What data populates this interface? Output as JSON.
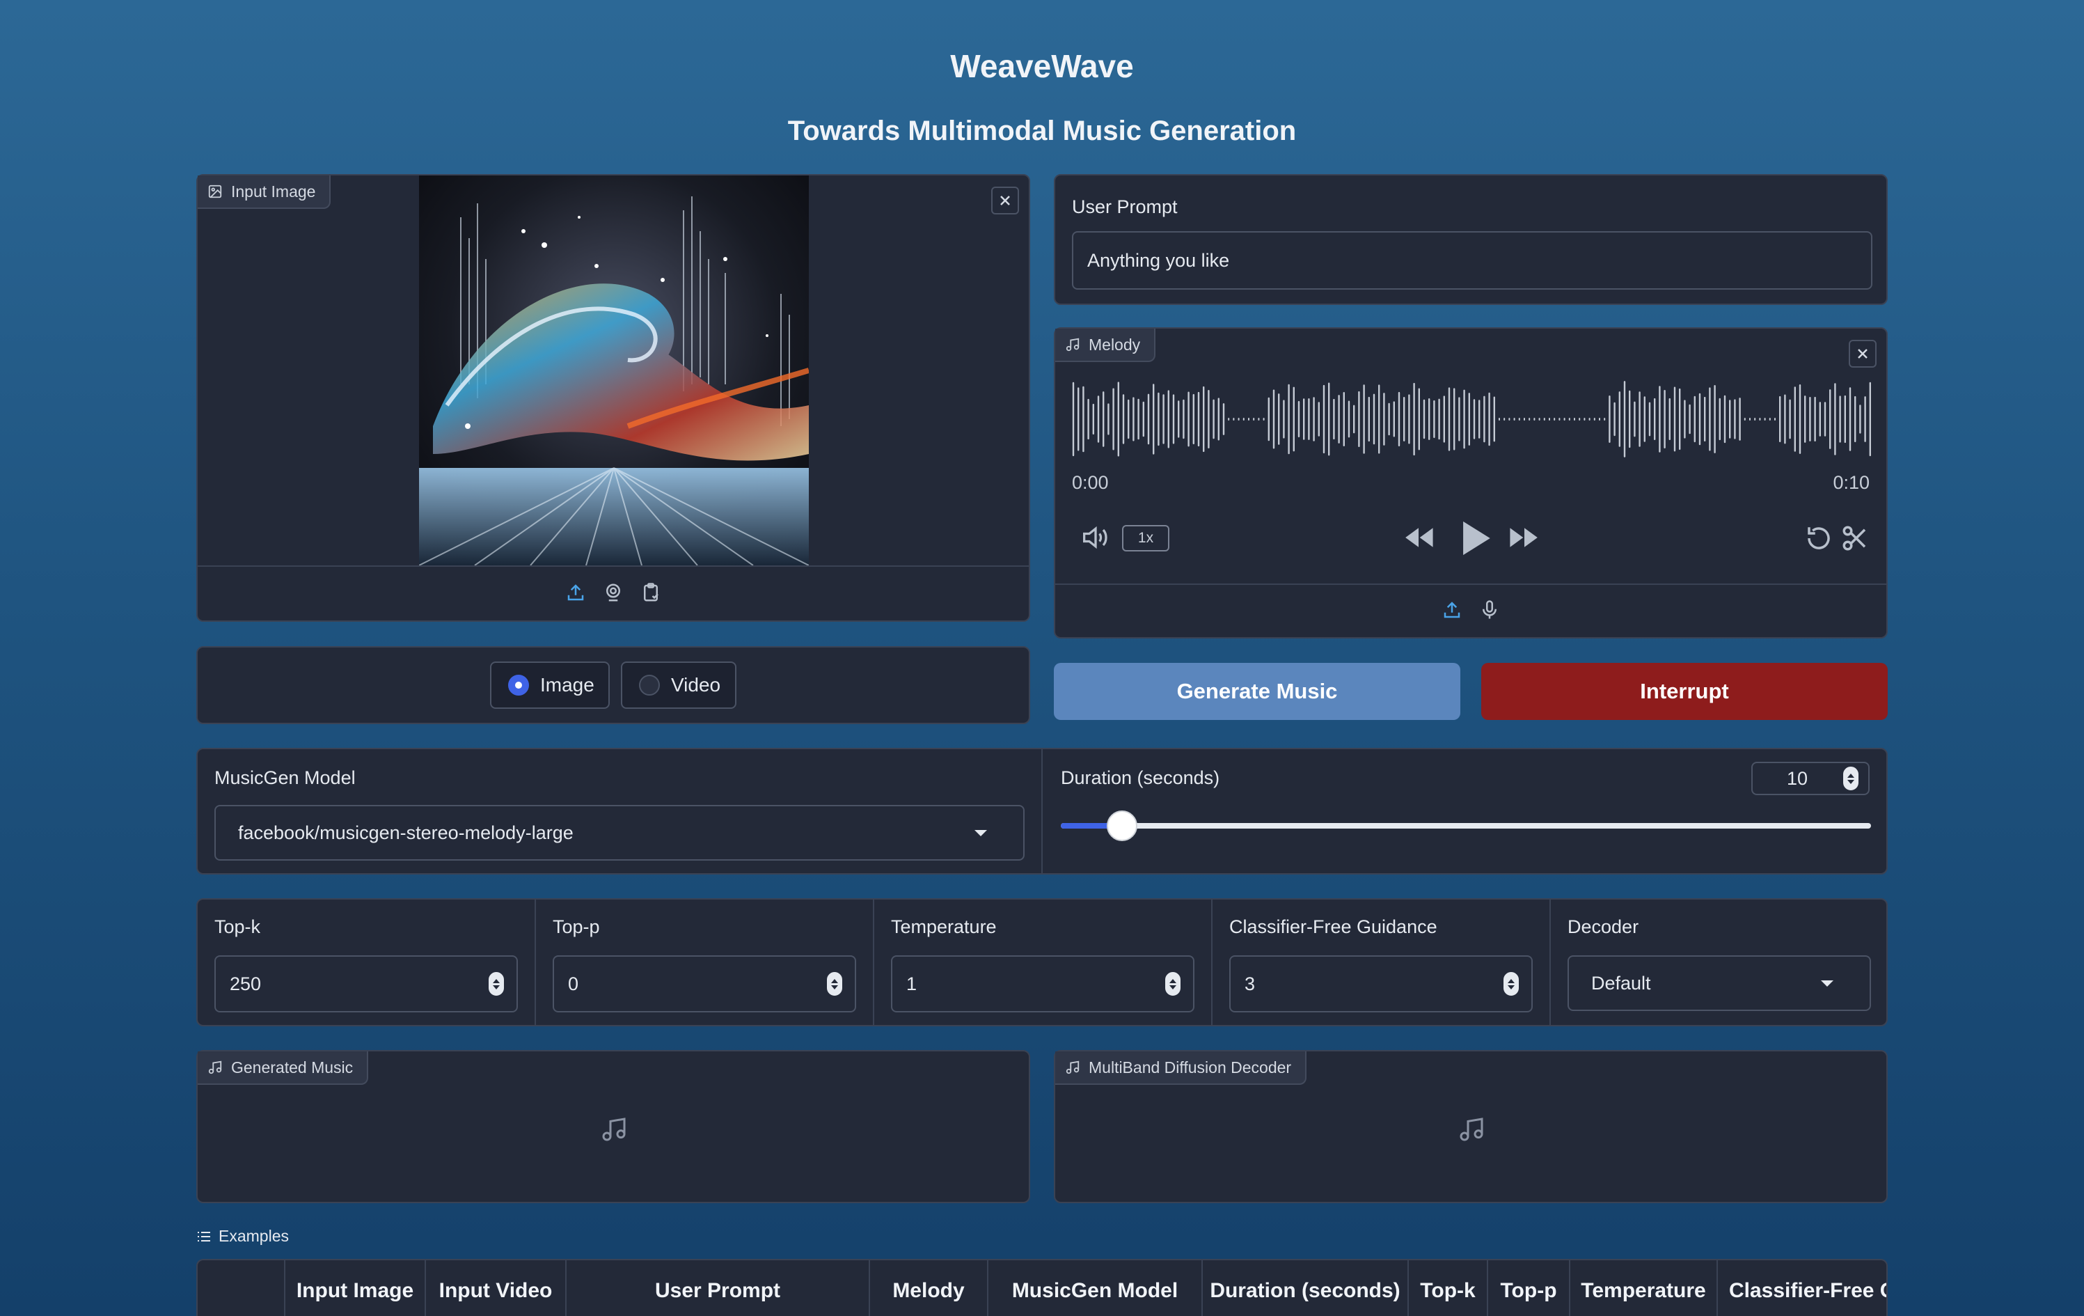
{
  "app": {
    "title": "WeaveWave",
    "subtitle": "Towards Multimodal Music Generation"
  },
  "input_image": {
    "label": "Input Image",
    "close_icon": "close-icon",
    "toolbar_icons": [
      "upload-icon",
      "webcam-icon",
      "clipboard-icon"
    ]
  },
  "user_prompt": {
    "label": "User Prompt",
    "value": "Anything you like"
  },
  "melody": {
    "label": "Melody",
    "time_start": "0:00",
    "time_end": "0:10",
    "speed": "1x"
  },
  "mode": {
    "options": [
      "Image",
      "Video"
    ],
    "selected": "Image"
  },
  "actions": {
    "generate": "Generate Music",
    "interrupt": "Interrupt"
  },
  "model": {
    "label": "MusicGen Model",
    "value": "facebook/musicgen-stereo-melody-large"
  },
  "duration": {
    "label": "Duration (seconds)",
    "value": "10",
    "min": 1,
    "max": 120
  },
  "params": {
    "topk_label": "Top-k",
    "topk": "250",
    "topp_label": "Top-p",
    "topp": "0",
    "temp_label": "Temperature",
    "temp": "1",
    "cfg_label": "Classifier-Free Guidance",
    "cfg": "3",
    "decoder_label": "Decoder",
    "decoder": "Default"
  },
  "outputs": {
    "generated": "Generated Music",
    "multiband": "MultiBand Diffusion Decoder"
  },
  "examples": {
    "label": "Examples",
    "headers": [
      "Input Image",
      "Input Video",
      "User Prompt",
      "Melody",
      "MusicGen Model",
      "Duration (seconds)",
      "Top-k",
      "Top-p",
      "Temperature",
      "Classifier-Free G"
    ]
  },
  "colors": {
    "generate_bg": "#5b86bd",
    "interrupt_bg": "#8e1c1c",
    "accent": "#3f63e6"
  }
}
